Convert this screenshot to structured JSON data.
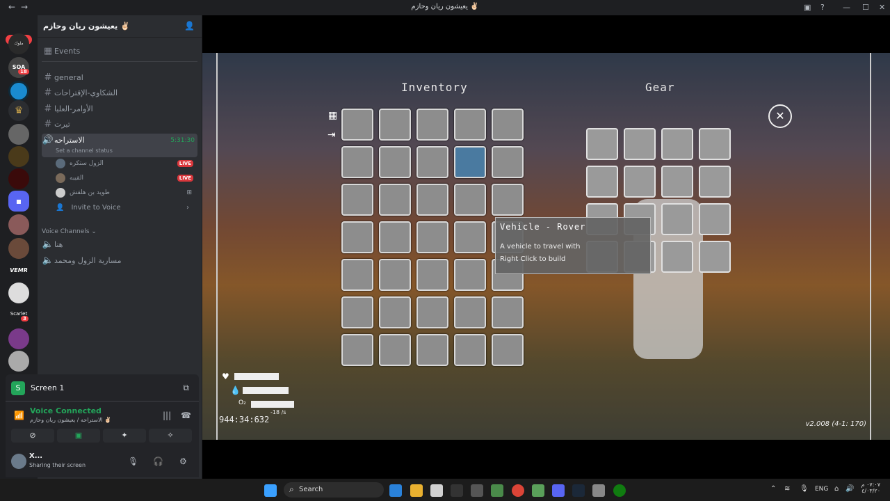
{
  "window": {
    "title": "يعيشون ريان وحازم ✌🏻",
    "back_label": "←",
    "forward_label": "→"
  },
  "servers": {
    "new_badge": "NEW",
    "items": [
      {
        "label": "ملوك الشيطون",
        "badge": ""
      },
      {
        "label": "SOA",
        "badge": "18"
      },
      {
        "label": "",
        "badge": ""
      },
      {
        "label": "",
        "badge": ""
      },
      {
        "label": "VEMR",
        "badge": ""
      },
      {
        "label": "Scarlet",
        "badge": "3"
      }
    ]
  },
  "guild": {
    "name": "يعيشون ريان وحازم ✌🏻",
    "events_label": "Events",
    "channels": [
      {
        "name": "general",
        "type": "text"
      },
      {
        "name": "الشكاوي-الإقتراحات",
        "type": "text"
      },
      {
        "name": "الأوامر-العليا",
        "type": "text"
      },
      {
        "name": "تيرت",
        "type": "text"
      }
    ],
    "active_voice": {
      "name": "الاستراحه",
      "timer": "5:31:30",
      "status": "Set a channel status",
      "users": [
        {
          "name": "الزول ستكره",
          "live": "LIVE"
        },
        {
          "name": "القيبه",
          "live": "LIVE"
        },
        {
          "name": "طويد بن هلقش",
          "live": ""
        }
      ],
      "invite": "Invite to Voice"
    },
    "voice_category": "Voice Channels",
    "voice_channels": [
      "هنا",
      "مسارية الزول ومحمد"
    ]
  },
  "panel": {
    "screen_label": "Screen 1",
    "voice_connected": "Voice Connected",
    "voice_sub": "الاستراحه / يعيشون ريان وحازم ✌🏻",
    "user_name": "X...",
    "user_status": "Sharing their screen"
  },
  "game": {
    "inventory_title": "Inventory",
    "gear_title": "Gear",
    "tooltip_title": "Vehicle - Rover",
    "tooltip_line1": "A vehicle to travel with",
    "tooltip_line2": "Right Click to build",
    "coords": "944:34:632",
    "version": "v2.008 (4-1: 170)",
    "speed": "-18 /s",
    "close": "✕"
  },
  "taskbar": {
    "search_label": "Search",
    "lang": "ENG",
    "time": "٠٧:٠٧ م",
    "date": "٤/٠٣/٢٠"
  },
  "colors": {
    "accent": "#5865f2",
    "live": "#da373c",
    "voice": "#23a55a"
  }
}
